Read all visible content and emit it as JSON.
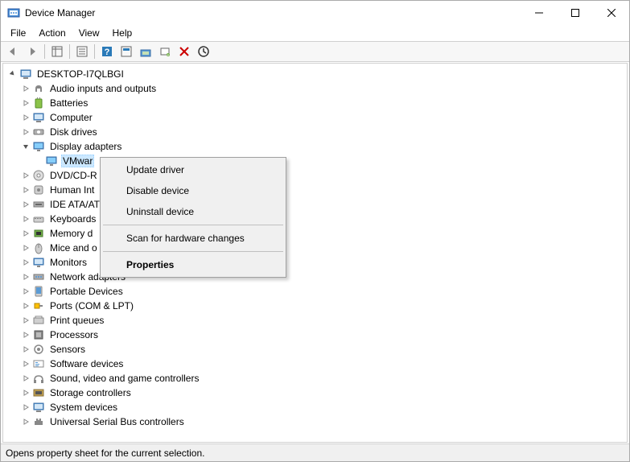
{
  "window": {
    "title": "Device Manager"
  },
  "menubar": {
    "file": "File",
    "action": "Action",
    "view": "View",
    "help": "Help"
  },
  "tree": {
    "root": "DESKTOP-I7QLBGI",
    "categories": [
      "Audio inputs and outputs",
      "Batteries",
      "Computer",
      "Disk drives",
      "Display adapters",
      "DVD/CD-R",
      "Human Int",
      "IDE ATA/AT",
      "Keyboards",
      "Memory d",
      "Mice and o",
      "Monitors",
      "Network adapters",
      "Portable Devices",
      "Ports (COM & LPT)",
      "Print queues",
      "Processors",
      "Sensors",
      "Software devices",
      "Sound, video and game controllers",
      "Storage controllers",
      "System devices",
      "Universal Serial Bus controllers"
    ],
    "display_device": "VMwar"
  },
  "context_menu": {
    "update": "Update driver",
    "disable": "Disable device",
    "uninstall": "Uninstall device",
    "scan": "Scan for hardware changes",
    "properties": "Properties"
  },
  "statusbar": {
    "text": "Opens property sheet for the current selection."
  }
}
